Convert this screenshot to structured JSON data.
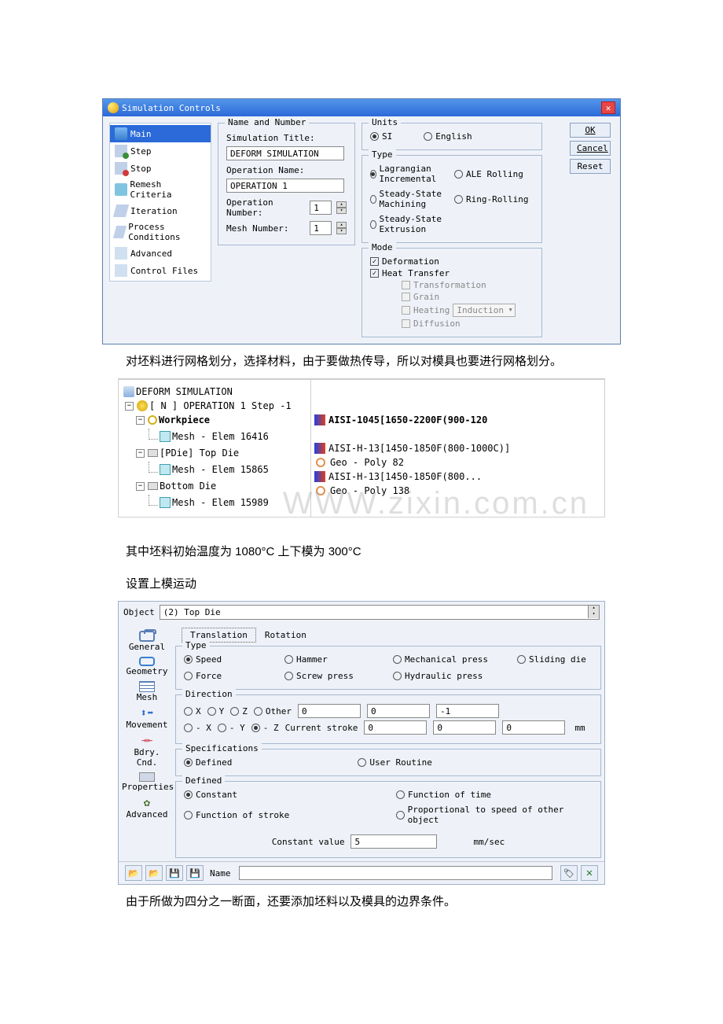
{
  "dialog1": {
    "title": "Simulation Controls",
    "nav": {
      "main": "Main",
      "step": "Step",
      "stop": "Stop",
      "remesh": "Remesh Criteria",
      "iteration": "Iteration",
      "process": "Process Conditions",
      "advanced": "Advanced",
      "control_files": "Control Files"
    },
    "name_number": {
      "group": "Name and Number",
      "sim_title_label": "Simulation Title:",
      "sim_title_value": "DEFORM SIMULATION",
      "op_name_label": "Operation Name:",
      "op_name_value": "OPERATION 1",
      "op_number_label": "Operation Number:",
      "op_number_value": "1",
      "mesh_number_label": "Mesh Number:",
      "mesh_number_value": "1"
    },
    "units": {
      "group": "Units",
      "si": "SI",
      "english": "English"
    },
    "type": {
      "group": "Type",
      "lagrangian": "Lagrangian Incremental",
      "ale": "ALE Rolling",
      "machining": "Steady-State Machining",
      "ring": "Ring-Rolling",
      "extrusion": "Steady-State Extrusion"
    },
    "mode": {
      "group": "Mode",
      "deformation": "Deformation",
      "heat": "Heat Transfer",
      "transformation": "Transformation",
      "grain": "Grain",
      "heating": "Heating",
      "induction": "Induction",
      "diffusion": "Diffusion"
    },
    "buttons": {
      "ok": "OK",
      "cancel": "Cancel",
      "reset": "Reset"
    }
  },
  "para1": "对坯料进行网格划分，选择材料，由于要做热传导，所以对模具也要进行网格划分。",
  "tree": {
    "root": "DEFORM SIMULATION",
    "op": "[ N ]  OPERATION 1  Step -1",
    "wp": "Workpiece",
    "wp_mat": "AISI-1045[1650-2200F(900-120",
    "wp_mesh": "Mesh - Elem 16416",
    "top": "[PDie] Top Die",
    "top_mat": "AISI-H-13[1450-1850F(800-1000C)]",
    "top_mesh": "Mesh - Elem 15865",
    "top_geo": "Geo - Poly 82",
    "bot": "Bottom Die",
    "bot_mat": "AISI-H-13[1450-1850F(800...",
    "bot_mesh": "Mesh - Elem 15989",
    "bot_geo": "Geo - Poly 138"
  },
  "watermark": "WWW.zixin.com.cn",
  "para2": "其中坯料初始温度为 1080°C  上下模为 300°C",
  "para3": "设置上模运动",
  "dialog3": {
    "object_label": "Object",
    "object_value": "(2) Top Die",
    "tabs": {
      "translation": "Translation",
      "rotation": "Rotation"
    },
    "side": {
      "general": "General",
      "geometry": "Geometry",
      "mesh": "Mesh",
      "movement": "Movement",
      "bdry": "Bdry. Cnd.",
      "properties": "Properties",
      "advanced": "Advanced"
    },
    "type": {
      "group": "Type",
      "speed": "Speed",
      "hammer": "Hammer",
      "mech": "Mechanical press",
      "sliding": "Sliding die",
      "force": "Force",
      "screw": "Screw press",
      "hydraulic": "Hydraulic press"
    },
    "direction": {
      "group": "Direction",
      "x": "X",
      "y": "Y",
      "z": "Z",
      "other": "Other",
      "mx": "- X",
      "my": "- Y",
      "mz": "- Z",
      "vec0": "0",
      "vec1": "0",
      "vec2": "-1",
      "stroke_label": "Current stroke",
      "stroke0": "0",
      "stroke1": "0",
      "stroke2": "0",
      "unit": "mm"
    },
    "spec": {
      "group": "Specifications",
      "defined": "Defined",
      "user": "User Routine"
    },
    "defined": {
      "group": "Defined",
      "constant": "Constant",
      "fn_time": "Function of time",
      "fn_stroke": "Function of stroke",
      "prop": "Proportional to speed of other object",
      "const_label": "Constant value",
      "const_value": "5",
      "const_unit": "mm/sec"
    },
    "name_label": "Name"
  },
  "para4": "由于所做为四分之一断面，还要添加坯料以及模具的边界条件。"
}
